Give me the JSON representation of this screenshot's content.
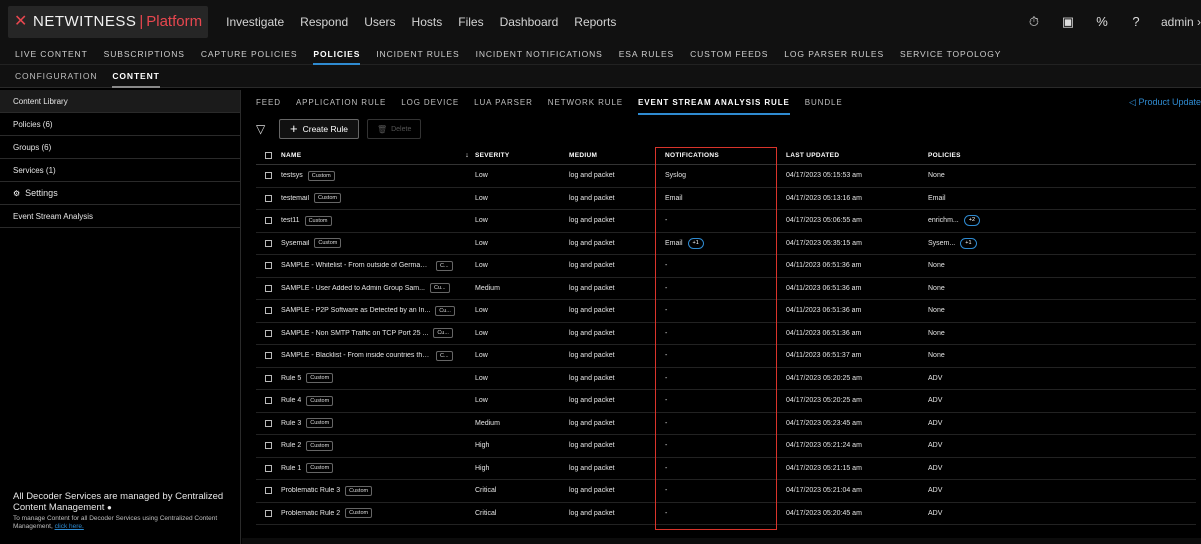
{
  "topbar": {
    "logo_brand": "NETWITNESS",
    "logo_product": "Platform",
    "nav": [
      "Investigate",
      "Respond",
      "Users",
      "Hosts",
      "Files",
      "Dashboard",
      "Reports"
    ],
    "admin_label": "admin"
  },
  "admin_nav": {
    "items": [
      "LIVE CONTENT",
      "SUBSCRIPTIONS",
      "CAPTURE POLICIES",
      "POLICIES",
      "INCIDENT RULES",
      "INCIDENT NOTIFICATIONS",
      "ESA RULES",
      "CUSTOM FEEDS",
      "LOG PARSER RULES",
      "SERVICE TOPOLOGY"
    ],
    "active_index": 3
  },
  "sub_nav": {
    "items": [
      "CONFIGURATION",
      "CONTENT"
    ],
    "active_index": 1
  },
  "sidebar": {
    "items": [
      "Content Library",
      "Policies (6)",
      "Groups (6)",
      "Services (1)"
    ],
    "settings_label": "Settings",
    "settings_sub": "Event Stream Analysis",
    "footer_title": "All Decoder Services are managed by Centralized Content Management",
    "footer_text": "To manage Content for all Decoder Services using Centralized Content Management,",
    "footer_link": "click here."
  },
  "tabs": {
    "items": [
      "FEED",
      "APPLICATION RULE",
      "LOG DEVICE",
      "LUA PARSER",
      "NETWORK RULE",
      "EVENT STREAM ANALYSIS RULE",
      "BUNDLE"
    ],
    "active_index": 5,
    "product_update": "Product Update"
  },
  "toolbar": {
    "create_label": "Create Rule",
    "delete_label": "Delete"
  },
  "table": {
    "headers": {
      "name": "NAME",
      "severity": "SEVERITY",
      "medium": "MEDIUM",
      "notifications": "NOTIFICATIONS",
      "last_updated": "LAST UPDATED",
      "policies": "POLICIES"
    },
    "rows": [
      {
        "name": "testsys",
        "badge": "Custom",
        "severity": "Low",
        "medium": "log and packet",
        "notifications": "Syslog",
        "notif_more": "",
        "last_updated": "04/17/2023 05:15:53 am",
        "policies": "None",
        "pol_more": ""
      },
      {
        "name": "testemail",
        "badge": "Custom",
        "severity": "Low",
        "medium": "log and packet",
        "notifications": "Email",
        "notif_more": "",
        "last_updated": "04/17/2023 05:13:16 am",
        "policies": "Email",
        "pol_more": ""
      },
      {
        "name": "test11",
        "badge": "Custom",
        "severity": "Low",
        "medium": "log and packet",
        "notifications": "-",
        "notif_more": "",
        "last_updated": "04/17/2023 05:06:55 am",
        "policies": "enrichm...",
        "pol_more": "+2"
      },
      {
        "name": "Sysemail",
        "badge": "Custom",
        "severity": "Low",
        "medium": "log and packet",
        "notifications": "Email",
        "notif_more": "+1",
        "last_updated": "04/17/2023 05:35:15 am",
        "policies": "Sysem...",
        "pol_more": "+1"
      },
      {
        "name": "SAMPLE - Whitelist - From outside of Germany,...",
        "badge": "C...",
        "severity": "Low",
        "medium": "log and packet",
        "notifications": "-",
        "notif_more": "",
        "last_updated": "04/11/2023 06:51:36 am",
        "policies": "None",
        "pol_more": ""
      },
      {
        "name": "SAMPLE - User Added to Admin Group Sam...",
        "badge": "Cu...",
        "severity": "Medium",
        "medium": "log and packet",
        "notifications": "-",
        "notif_more": "",
        "last_updated": "04/11/2023 06:51:36 am",
        "policies": "None",
        "pol_more": ""
      },
      {
        "name": "SAMPLE - P2P Software as Detected by an In...",
        "badge": "Cu...",
        "severity": "Low",
        "medium": "log and packet",
        "notifications": "-",
        "notif_more": "",
        "last_updated": "04/11/2023 06:51:36 am",
        "policies": "None",
        "pol_more": ""
      },
      {
        "name": "SAMPLE - Non SMTP Traffic on TCP Port 25 ...",
        "badge": "Cu...",
        "severity": "Low",
        "medium": "log and packet",
        "notifications": "-",
        "notif_more": "",
        "last_updated": "04/11/2023 06:51:36 am",
        "policies": "None",
        "pol_more": ""
      },
      {
        "name": "SAMPLE - Blacklist - From inside countries that ...",
        "badge": "C...",
        "severity": "Low",
        "medium": "log and packet",
        "notifications": "-",
        "notif_more": "",
        "last_updated": "04/11/2023 06:51:37 am",
        "policies": "None",
        "pol_more": ""
      },
      {
        "name": "Rule 5",
        "badge": "Custom",
        "severity": "Low",
        "medium": "log and packet",
        "notifications": "-",
        "notif_more": "",
        "last_updated": "04/17/2023 05:20:25 am",
        "policies": "ADV",
        "pol_more": ""
      },
      {
        "name": "Rule 4",
        "badge": "Custom",
        "severity": "Low",
        "medium": "log and packet",
        "notifications": "-",
        "notif_more": "",
        "last_updated": "04/17/2023 05:20:25 am",
        "policies": "ADV",
        "pol_more": ""
      },
      {
        "name": "Rule 3",
        "badge": "Custom",
        "severity": "Medium",
        "medium": "log and packet",
        "notifications": "-",
        "notif_more": "",
        "last_updated": "04/17/2023 05:23:45 am",
        "policies": "ADV",
        "pol_more": ""
      },
      {
        "name": "Rule 2",
        "badge": "Custom",
        "severity": "High",
        "medium": "log and packet",
        "notifications": "-",
        "notif_more": "",
        "last_updated": "04/17/2023 05:21:24 am",
        "policies": "ADV",
        "pol_more": ""
      },
      {
        "name": "Rule 1",
        "badge": "Custom",
        "severity": "High",
        "medium": "log and packet",
        "notifications": "-",
        "notif_more": "",
        "last_updated": "04/17/2023 05:21:15 am",
        "policies": "ADV",
        "pol_more": ""
      },
      {
        "name": "Problematic Rule 3",
        "badge": "Custom",
        "severity": "Critical",
        "medium": "log and packet",
        "notifications": "-",
        "notif_more": "",
        "last_updated": "04/17/2023 05:21:04 am",
        "policies": "ADV",
        "pol_more": ""
      },
      {
        "name": "Problematic Rule 2",
        "badge": "Custom",
        "severity": "Critical",
        "medium": "log and packet",
        "notifications": "-",
        "notif_more": "",
        "last_updated": "04/17/2023 05:20:45 am",
        "policies": "ADV",
        "pol_more": ""
      }
    ]
  },
  "colors": {
    "accent": "#2f8bd1",
    "highlight_box": "#d9342b",
    "brand_red": "#e8474f"
  }
}
